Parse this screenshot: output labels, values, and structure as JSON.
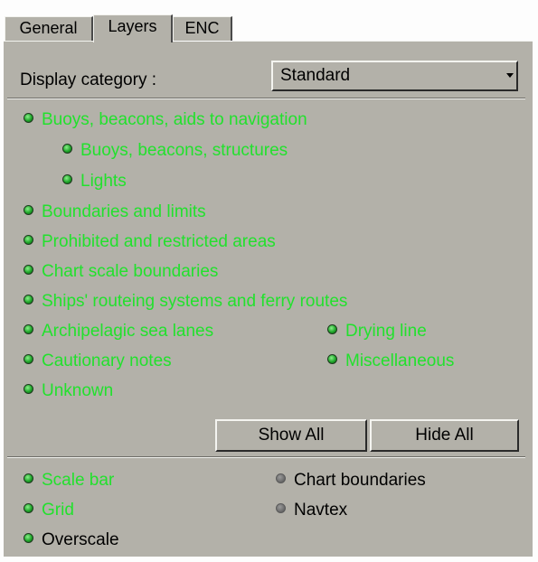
{
  "tabs": [
    "General",
    "Layers",
    "ENC"
  ],
  "category": {
    "label": "Display category :",
    "value": "Standard"
  },
  "layers": [
    {
      "label": "Buoys, beacons, aids to navigation",
      "on": true
    },
    {
      "label": "Buoys, beacons, structures",
      "on": true
    },
    {
      "label": "Lights",
      "on": true
    },
    {
      "label": "Boundaries and limits",
      "on": true
    },
    {
      "label": "Prohibited and restricted areas",
      "on": true
    },
    {
      "label": "Chart scale boundaries",
      "on": true
    },
    {
      "label": "Ships' routeing systems and ferry routes",
      "on": true
    },
    {
      "label": "Archipelagic sea lanes",
      "on": true
    },
    {
      "label": "Drying line",
      "on": true
    },
    {
      "label": "Cautionary notes",
      "on": true
    },
    {
      "label": "Miscellaneous",
      "on": true
    },
    {
      "label": "Unknown",
      "on": true
    }
  ],
  "buttons": {
    "show_all": "Show All",
    "hide_all": "Hide All"
  },
  "extras": [
    {
      "label": "Scale bar",
      "on": true
    },
    {
      "label": "Chart boundaries",
      "on": false
    },
    {
      "label": "Grid",
      "on": true
    },
    {
      "label": "Navtex",
      "on": false
    },
    {
      "label": "Overscale",
      "on": true
    }
  ],
  "colors": {
    "active_text": "#22e12d",
    "panel": "#b3b1a9"
  }
}
